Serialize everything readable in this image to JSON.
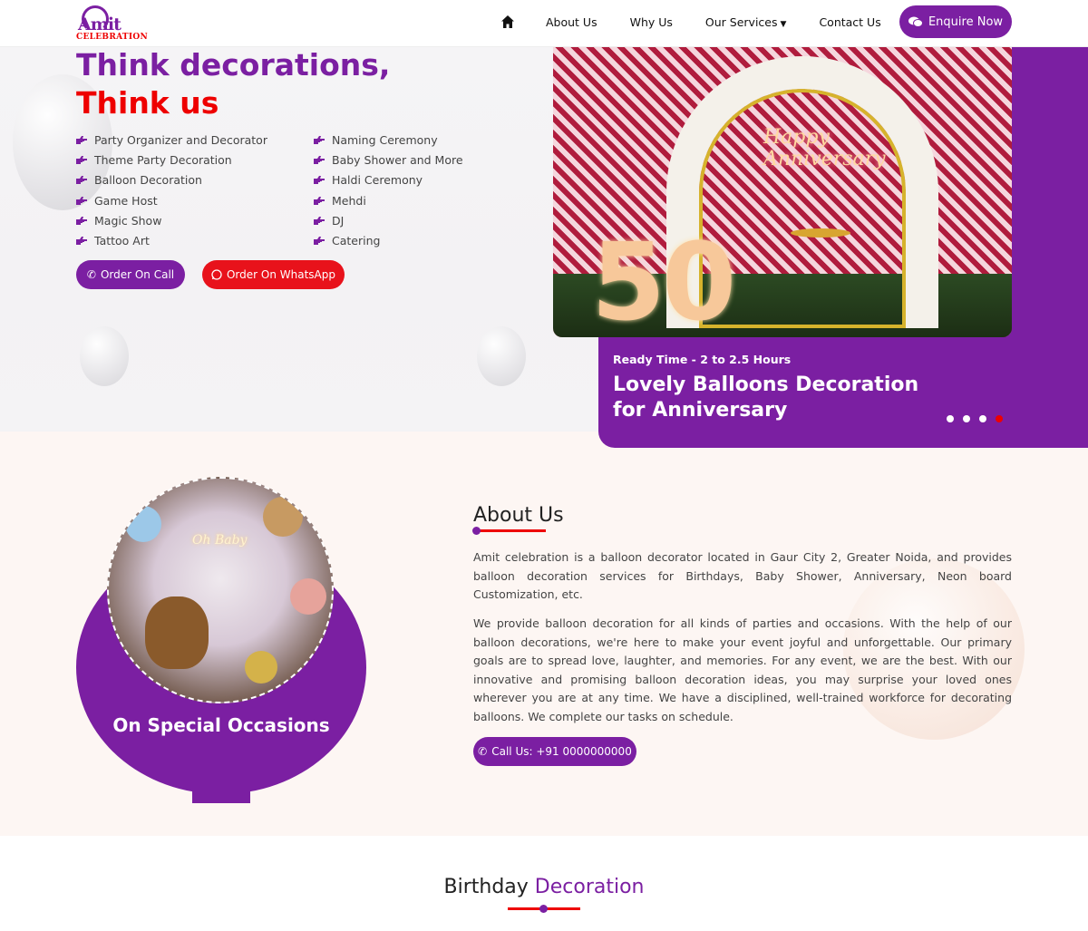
{
  "brand": {
    "logo_word": "Amit",
    "logo_sub": "CELEBRATION"
  },
  "nav": {
    "items": [
      "About Us",
      "Why Us",
      "Our Services",
      "Contact Us"
    ],
    "enquire_label": "Enquire Now"
  },
  "hero": {
    "headline1": "Think decorations,",
    "headline2": "Think us",
    "services_left": [
      "Party Organizer and Decorator",
      "Theme Party Decoration",
      "Balloon Decoration",
      "Game Host",
      "Magic Show",
      "Tattoo Art"
    ],
    "services_right": [
      "Naming Ceremony",
      "Baby Shower and More",
      "Haldi Ceremony",
      "Mehdi",
      "DJ",
      "Catering"
    ],
    "order_call_label": "Order On Call",
    "order_whatsapp_label": "Order On WhatsApp"
  },
  "slider": {
    "neon_line1": "Happy",
    "neon_line2": "Anniversary",
    "number": "50",
    "ready_time": "Ready Time - 2 to 2.5 Hours",
    "title": "Lovely Balloons Decoration for Anniversary",
    "dot_count": 4,
    "active_dot": 4
  },
  "about": {
    "photo_text": "Oh Baby",
    "occasions_label": "On Special Occasions",
    "title": "About Us",
    "paragraph1": "Amit celebration is a balloon decorator located in Gaur City 2, Greater Noida, and provides balloon decoration services for Birthdays, Baby Shower, Anniversary, Neon board Customization, etc.",
    "paragraph2": "We provide balloon decoration for all kinds of parties and occasions. With the help of our balloon decorations, we're here to make your event joyful and unforgettable. Our primary goals are to spread love, laughter, and memories. For any event, we are the best. With our innovative and promising balloon decoration ideas, you may surprise your loved ones wherever you are at any time. We have a disciplined, well-trained workforce for decorating balloons. We complete our tasks on schedule.",
    "call_label": "Call Us: +91 0000000000"
  },
  "birthday": {
    "title_plain": "Birthday",
    "title_accent": "Decoration"
  },
  "colors": {
    "primary": "#7b1fa2",
    "accent": "#e00000",
    "whatsapp_btn": "#e8121b"
  },
  "icons": [
    "home-icon",
    "chevron-down-icon",
    "chat-icon",
    "pointing-hand-icon",
    "phone-icon",
    "whatsapp-icon"
  ]
}
